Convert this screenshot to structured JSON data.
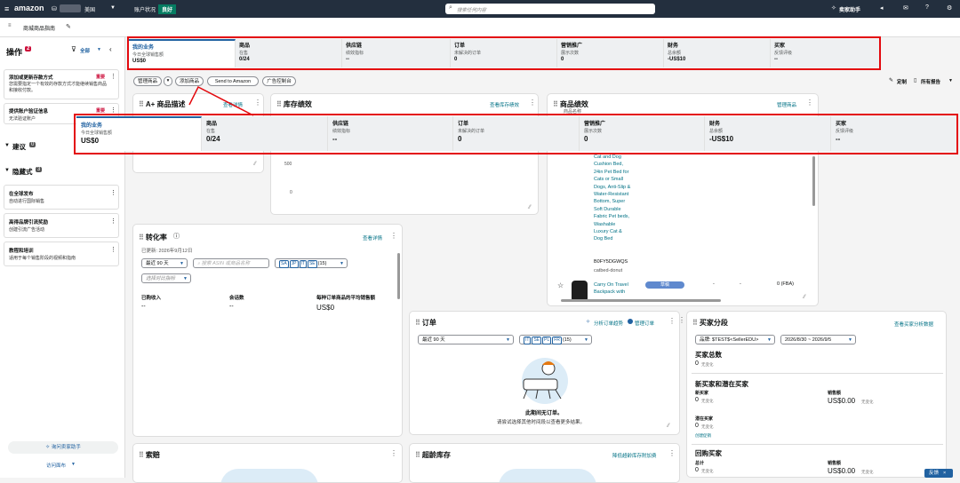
{
  "topbar": {
    "brand": "amazon",
    "store": "美国",
    "account_health_label": "账户状况",
    "account_health_value": "良好",
    "search_placeholder": "搜索任何内容",
    "assistant": "卖家助手"
  },
  "subbar": {
    "page": "商城商品指南"
  },
  "left": {
    "actions_title": "操作",
    "actions_count": "2",
    "filter": "全部",
    "tasks": [
      {
        "title": "添加或更新存款方式",
        "tag": "重要",
        "desc": "您需要指定一个有效的存款方式才能继续销售商品和接收付款。"
      },
      {
        "title": "提供账户验证信息",
        "tag": "重要",
        "desc": "无法验证账户"
      }
    ],
    "suggest_title": "建议",
    "suggest_count": "0",
    "hidden_title": "隐藏式",
    "hidden_count": "3",
    "hidden": [
      {
        "title": "在全球发布",
        "desc": "自动进行国际销售"
      },
      {
        "title": "高得品牌引流奖励",
        "desc": "创建引流广告活动"
      },
      {
        "title": "教程和培训",
        "desc": "适用于每个销售阶段的视频和指南"
      }
    ],
    "ask_assistant": "询问卖家助手",
    "visit_forum": "访问面布"
  },
  "metrics": [
    {
      "title": "我的业务",
      "sub": "今日全球销售额",
      "value": "US$0"
    },
    {
      "title": "商品",
      "sub": "在售",
      "value": "0/24"
    },
    {
      "title": "供应链",
      "sub": "绩效指标",
      "value": "--"
    },
    {
      "title": "订单",
      "sub": "未解决的订单",
      "value": "0"
    },
    {
      "title": "营销推广",
      "sub": "展示次数",
      "value": "0"
    },
    {
      "title": "财务",
      "sub": "总余额",
      "value": "-US$10"
    },
    {
      "title": "买家",
      "sub": "反馈评级",
      "value": "--"
    }
  ],
  "buttons": {
    "manage": "管理商品",
    "add": "添加商品",
    "send": "Send to Amazon",
    "ads": "广告控制台",
    "custom": "定制",
    "reports": "所有报告"
  },
  "cards": {
    "aplus": {
      "title": "A+ 商品描述",
      "link": "查看详情"
    },
    "inventory": {
      "title": "库存绩效",
      "link": "查看库存绩效",
      "y500": "500",
      "y0": "0"
    },
    "product": {
      "title": "商品绩效",
      "link": "管理商品",
      "cut": "商品名称",
      "name1": "Cat and Dog Cushion Bed, 24in Pet Bed for Cats or Small Dogs, Anti-Slip & Water-Resistant Bottom, Super Soft Durable Fabric Pet beds, Washable Luxury Cat & Dog Bed",
      "asin": "B0FY5DGWQS",
      "sku": "catbed-donut",
      "name2": "Carry On Travel Backpack with",
      "status": "草稿",
      "d1": "-",
      "d2": "-",
      "fba": "0 (FBA)"
    },
    "conversion": {
      "title": "转化率",
      "link": "查看详情",
      "updated": "已更新: 2026年9月12日",
      "range": "最近 90 天",
      "asin_ph": "搜索 ASIN 或商品名称",
      "chips": [
        "SA",
        "JP",
        "IT",
        "SE"
      ],
      "more": "(15)",
      "compare": "选择对比指标",
      "cols": [
        "已购收入",
        "会话数",
        "每种订单商品的平均销售额"
      ],
      "vals": [
        "--",
        "--",
        "US$0"
      ]
    },
    "orders": {
      "title": "订单",
      "link1": "分析订单趋势",
      "link2": "管理订单",
      "range": "最近 90 天",
      "chips": [
        "IT",
        "SE",
        "PL",
        "FR"
      ],
      "more": "(15)",
      "empty": "此期间无订单。",
      "hint": "请尝试选择其他时间段以查看更多结果。"
    },
    "buyers": {
      "title": "买家分段",
      "link": "查看买家分析数据",
      "brand": "品牌: $TEST$<SellerEDU>",
      "dates": "2026/8/30 ~ 2026/9/5",
      "total_title": "买家总数",
      "total": "0",
      "nochange": "无变化",
      "new_title": "新买家和潜在买家",
      "new_label": "新买家",
      "sales_label": "销售额",
      "new_val": "0",
      "sales_val": "US$0.00",
      "pot_label": "潜在买家",
      "pot_val": "0",
      "create": "创建促销",
      "repeat_title": "回购买家",
      "repeat_total": "总计",
      "repeat_val": "0",
      "repeat_sales": "US$0.00"
    },
    "claims": {
      "title": "索赔"
    },
    "aged": {
      "title": "超龄库存",
      "link": "降低超龄库存附加费"
    }
  },
  "feedback": "反馈"
}
